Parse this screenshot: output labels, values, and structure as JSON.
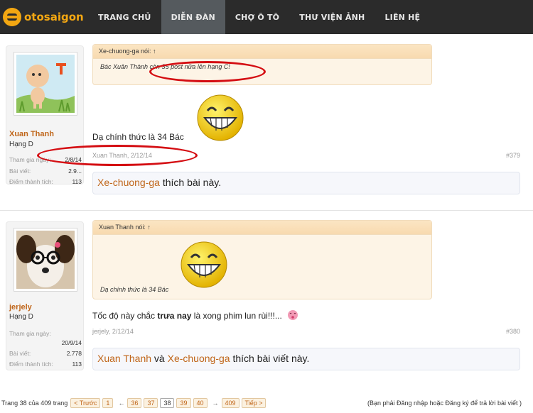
{
  "site": {
    "logo_text": "otosaigon"
  },
  "nav": [
    {
      "label": "TRANG CHỦ",
      "active": false
    },
    {
      "label": "DIỄN ĐÀN",
      "active": true
    },
    {
      "label": "CHỢ Ô TÔ",
      "active": false
    },
    {
      "label": "THƯ VIỆN ẢNH",
      "active": false
    },
    {
      "label": "LIÊN HỆ",
      "active": false
    }
  ],
  "posts": [
    {
      "user": {
        "name": "Xuan Thanh",
        "rank": "Hạng D",
        "stats": [
          {
            "label": "Tham gia ngày:",
            "value": "2/8/14"
          },
          {
            "label": "Bài viết:",
            "value": "2.9..."
          },
          {
            "label": "Điểm thành tích:",
            "value": "113"
          }
        ]
      },
      "quote": {
        "author": "Xe-chuong-ga nói: ↑",
        "text": "Bác Xuân Thành còn 35 post nữa lên hạng C!"
      },
      "message": "Dạ chính thức là 34 Bác",
      "meta": "Xuan Thanh, 2/12/14",
      "permalink": "#379",
      "likes": {
        "name": "Xe-chuong-ga",
        "text": " thích bài này."
      }
    },
    {
      "user": {
        "name": "jerjely",
        "rank": "Hạng D",
        "stats": [
          {
            "label": "Tham gia ngày:",
            "value": "20/9/14"
          },
          {
            "label": "Bài viết:",
            "value": "2.778"
          },
          {
            "label": "Điểm thành tích:",
            "value": "113"
          }
        ]
      },
      "quote": {
        "author": "Xuan Thanh nói: ↑",
        "text": "Dạ chính thức là 34 Bác"
      },
      "message_pre": "Tốc độ này chắc ",
      "message_bold": "trưa nay",
      "message_post": " là xong phim lun rùi!!!...",
      "meta": "jerjely, 2/12/14",
      "permalink": "#380",
      "likes": {
        "name1": "Xuan Thanh",
        "mid": " và ",
        "name2": "Xe-chuong-ga",
        "text": " thích bài viết này."
      }
    }
  ],
  "pagination": {
    "summary": "Trang 38 của 409 trang",
    "prev": "< Trước",
    "first": "1",
    "pages": [
      "36",
      "37",
      "38",
      "39",
      "40"
    ],
    "current": "38",
    "last": "409",
    "next": "Tiếp >",
    "arrow_left": "←",
    "arrow_right": "→",
    "login_note": "(Bạn phải Đăng nhập hoặc Đăng ký để trả lời bài viết )"
  },
  "colors": {
    "accent": "#c0661a",
    "nav_bg": "#2b2b2b",
    "annotation": "#d40d12",
    "logo": "#f3a712"
  }
}
